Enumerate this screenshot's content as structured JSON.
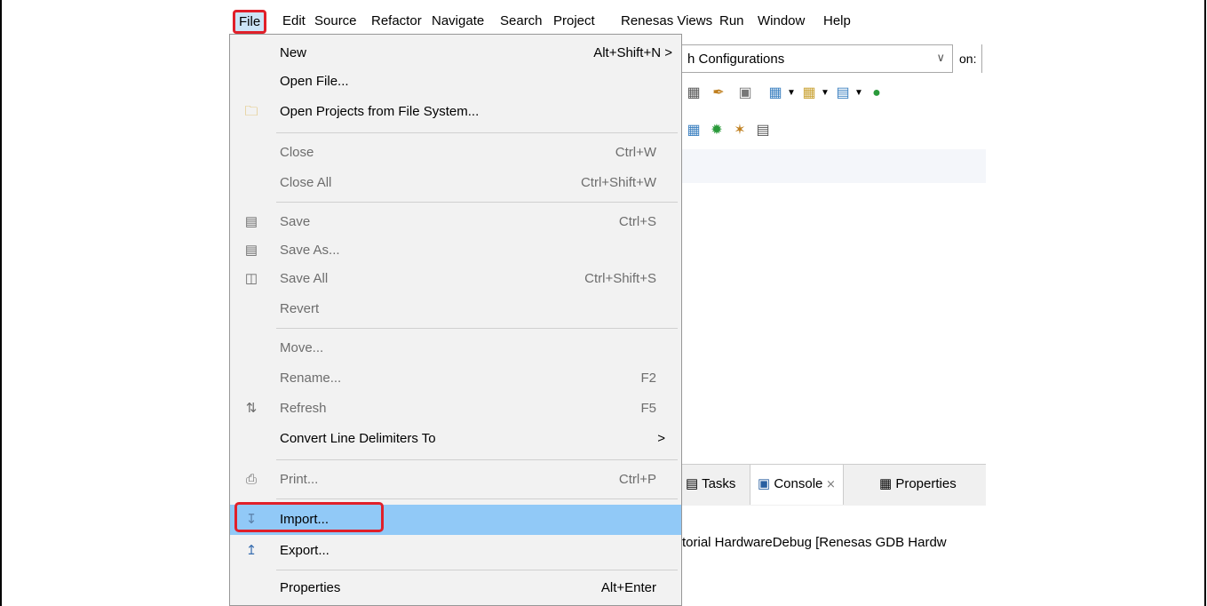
{
  "menubar": {
    "items": [
      "File",
      "Edit",
      "Source",
      "Refactor",
      "Navigate",
      "Search",
      "Project",
      "Renesas Views",
      "Run",
      "Window",
      "Help"
    ]
  },
  "background": {
    "config_combo": "h Configurations",
    "on_label": "on:",
    "tabs": [
      "Tasks",
      "Console",
      "Properties"
    ],
    "console_line": "torial HardwareDebug [Renesas GDB Hardw"
  },
  "file_menu": {
    "new": {
      "label": "New",
      "accel": "Alt+Shift+N >"
    },
    "open_file": {
      "label": "Open File..."
    },
    "open_projects": {
      "label": "Open Projects from File System..."
    },
    "close": {
      "label": "Close",
      "accel": "Ctrl+W"
    },
    "close_all": {
      "label": "Close All",
      "accel": "Ctrl+Shift+W"
    },
    "save": {
      "label": "Save",
      "accel": "Ctrl+S"
    },
    "save_as": {
      "label": "Save As..."
    },
    "save_all": {
      "label": "Save All",
      "accel": "Ctrl+Shift+S"
    },
    "revert": {
      "label": "Revert"
    },
    "move": {
      "label": "Move..."
    },
    "rename": {
      "label": "Rename...",
      "accel": "F2"
    },
    "refresh": {
      "label": "Refresh",
      "accel": "F5"
    },
    "convert": {
      "label": "Convert Line Delimiters To",
      "accel": ">"
    },
    "print": {
      "label": "Print...",
      "accel": "Ctrl+P"
    },
    "import": {
      "label": "Import..."
    },
    "export": {
      "label": "Export..."
    },
    "properties": {
      "label": "Properties",
      "accel": "Alt+Enter"
    }
  },
  "colors": {
    "highlight": "#91c9f7",
    "annotation": "#e0202a"
  }
}
